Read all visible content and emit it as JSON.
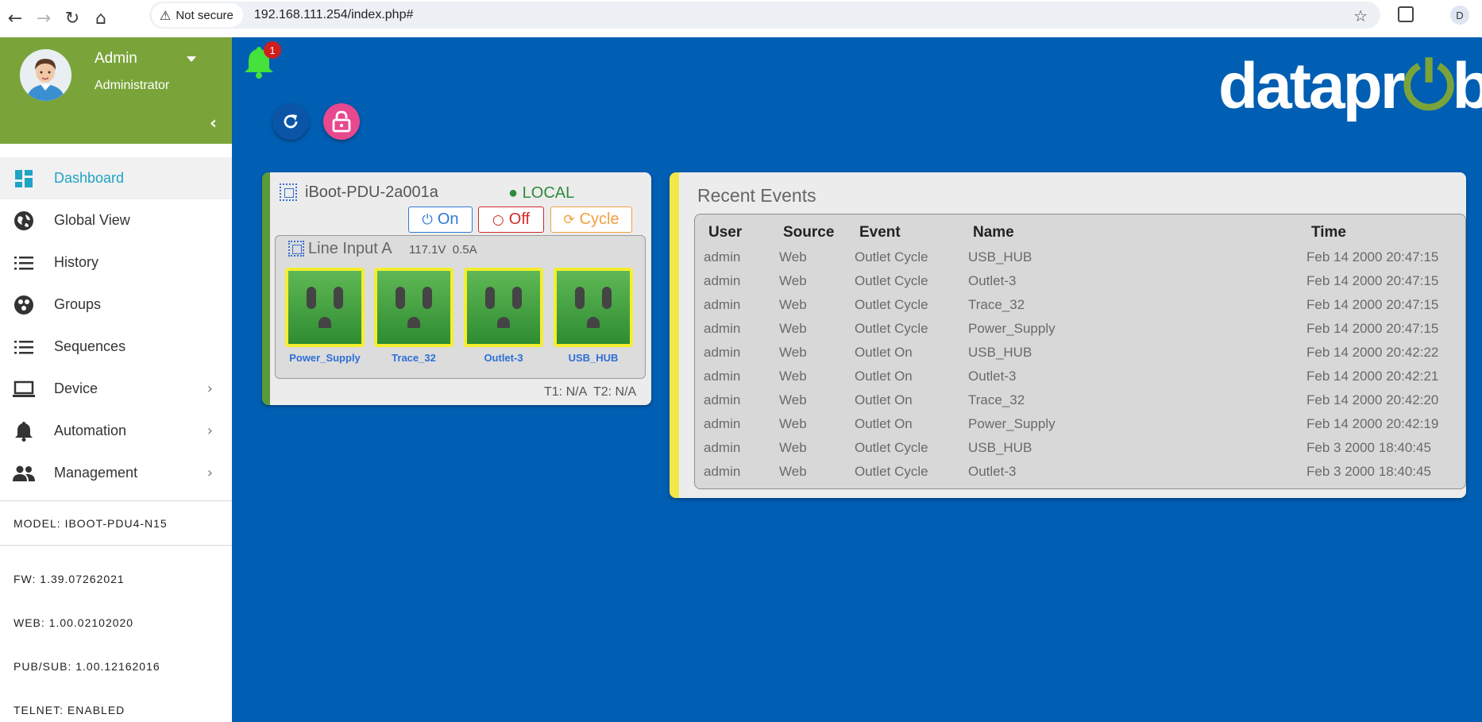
{
  "browser": {
    "security_label": "Not secure",
    "url": "192.168.111.254/index.php#",
    "profile_initial": "D"
  },
  "user": {
    "name": "Admin",
    "role": "Administrator"
  },
  "sidebar": {
    "items": [
      {
        "label": "Dashboard",
        "icon": "dashboard-icon",
        "active": true,
        "has_submenu": false
      },
      {
        "label": "Global View",
        "icon": "globe-icon",
        "active": false,
        "has_submenu": false
      },
      {
        "label": "History",
        "icon": "list-icon",
        "active": false,
        "has_submenu": false
      },
      {
        "label": "Groups",
        "icon": "groups-icon",
        "active": false,
        "has_submenu": false
      },
      {
        "label": "Sequences",
        "icon": "list-icon",
        "active": false,
        "has_submenu": false
      },
      {
        "label": "Device",
        "icon": "laptop-icon",
        "active": false,
        "has_submenu": true
      },
      {
        "label": "Automation",
        "icon": "bell-icon",
        "active": false,
        "has_submenu": true
      },
      {
        "label": "Management",
        "icon": "people-icon",
        "active": false,
        "has_submenu": true
      }
    ],
    "info": {
      "model": "MODEL: IBOOT-PDU4-N15",
      "fw": "FW: 1.39.07262021",
      "web": "WEB: 1.00.02102020",
      "pubsub": "PUB/SUB: 1.00.12162016",
      "telnet": "TELNET: ENABLED"
    }
  },
  "notifications": {
    "count": "1"
  },
  "brand": {
    "logo_text_a": "datapr",
    "logo_text_b": "be",
    "accent": "#7aa43a",
    "background": "#005eb3"
  },
  "device": {
    "name": "iBoot-PDU-2a001a",
    "status": "● LOCAL",
    "buttons": {
      "on": "On",
      "off": "Off",
      "cycle": "Cycle"
    },
    "line": {
      "title": "Line Input A",
      "voltage": "117.1V",
      "current": "0.5A"
    },
    "outlets": [
      {
        "name": "Power_Supply"
      },
      {
        "name": "Trace_32"
      },
      {
        "name": "Outlet-3"
      },
      {
        "name": "USB_HUB"
      }
    ],
    "temps": "T1: N/A  T2: N/A"
  },
  "events": {
    "title": "Recent Events",
    "columns": [
      "User",
      "Source",
      "Event",
      "Name",
      "Time"
    ],
    "rows": [
      [
        "admin",
        "Web",
        "Outlet Cycle",
        "USB_HUB",
        "Feb 14 2000 20:47:15"
      ],
      [
        "admin",
        "Web",
        "Outlet Cycle",
        "Outlet-3",
        "Feb 14 2000 20:47:15"
      ],
      [
        "admin",
        "Web",
        "Outlet Cycle",
        "Trace_32",
        "Feb 14 2000 20:47:15"
      ],
      [
        "admin",
        "Web",
        "Outlet Cycle",
        "Power_Supply",
        "Feb 14 2000 20:47:15"
      ],
      [
        "admin",
        "Web",
        "Outlet On",
        "USB_HUB",
        "Feb 14 2000 20:42:22"
      ],
      [
        "admin",
        "Web",
        "Outlet On",
        "Outlet-3",
        "Feb 14 2000 20:42:21"
      ],
      [
        "admin",
        "Web",
        "Outlet On",
        "Trace_32",
        "Feb 14 2000 20:42:20"
      ],
      [
        "admin",
        "Web",
        "Outlet On",
        "Power_Supply",
        "Feb 14 2000 20:42:19"
      ],
      [
        "admin",
        "Web",
        "Outlet Cycle",
        "USB_HUB",
        "Feb 3 2000 18:40:45"
      ],
      [
        "admin",
        "Web",
        "Outlet Cycle",
        "Outlet-3",
        "Feb 3 2000 18:40:45"
      ]
    ]
  }
}
